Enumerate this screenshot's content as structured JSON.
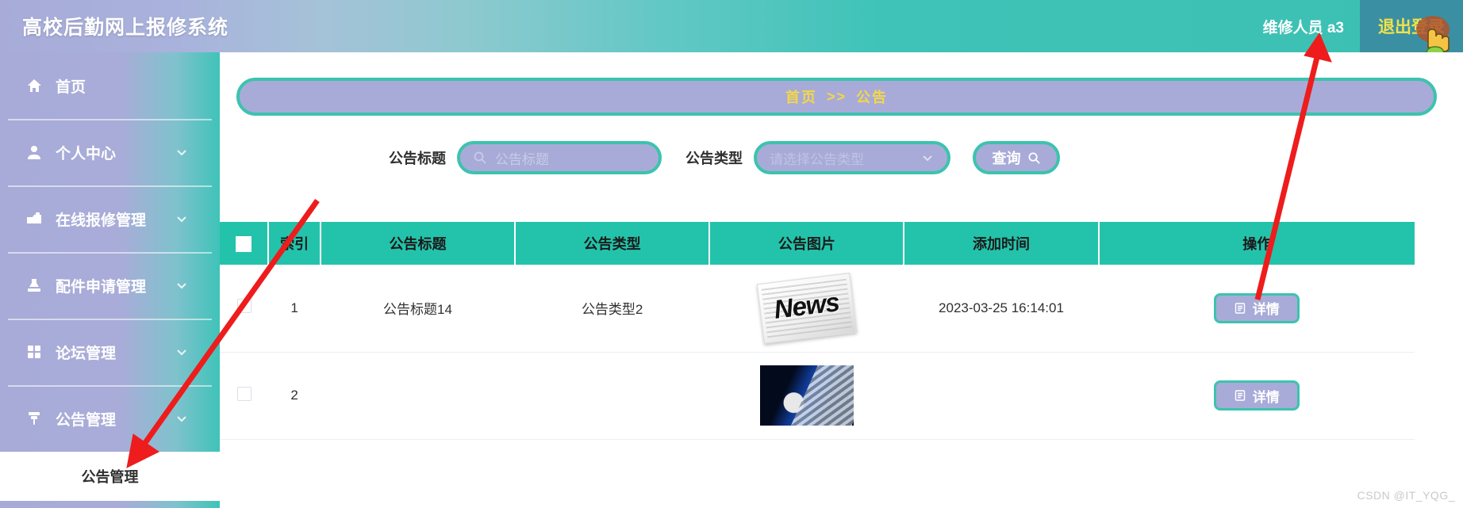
{
  "header": {
    "title": "高校后勤网上报修系统",
    "user_label": "维修人员 a3",
    "logout_label": "退出登录",
    "accent_teal": "#3cc3ae",
    "accent_purple": "#a8abd8",
    "logout_bg": "#3b8fa3",
    "logout_text_color": "#f0e24a"
  },
  "sidebar": {
    "items": [
      {
        "label": "首页",
        "icon": "home-icon",
        "has_chevron": false
      },
      {
        "label": "个人中心",
        "icon": "user-icon",
        "has_chevron": true
      },
      {
        "label": "在线报修管理",
        "icon": "tools-icon",
        "has_chevron": true
      },
      {
        "label": "配件申请管理",
        "icon": "stamp-icon",
        "has_chevron": true
      },
      {
        "label": "论坛管理",
        "icon": "grid-icon",
        "has_chevron": true
      },
      {
        "label": "公告管理",
        "icon": "pin-icon",
        "has_chevron": true
      }
    ],
    "submenu": {
      "label": "公告管理",
      "active": true
    }
  },
  "breadcrumb": {
    "root": "首页",
    "separator": ">>",
    "current": "公告"
  },
  "filters": {
    "title_label": "公告标题",
    "title_placeholder": "公告标题",
    "title_value": "",
    "type_label": "公告类型",
    "type_placeholder": "请选择公告类型",
    "type_value": "",
    "search_label": "查询",
    "search_icon": "magnifier-icon"
  },
  "table": {
    "headers": [
      "",
      "索引",
      "公告标题",
      "公告类型",
      "公告图片",
      "添加时间",
      "操作"
    ],
    "select_all_checked": true,
    "rows": [
      {
        "checked": false,
        "index": "1",
        "title": "公告标题14",
        "type": "公告类型2",
        "image": "news-paper-thumbnail",
        "time": "2023-03-25 16:14:01",
        "action_label": "详情",
        "action_icon": "document-icon"
      },
      {
        "checked": false,
        "index": "2",
        "title": "",
        "type": "",
        "image": "globe-keyboard-thumbnail",
        "time": "",
        "action_label": "详情",
        "action_icon": "document-icon"
      }
    ]
  },
  "annotations": {
    "arrow_to_logout": "red-arrow-pointing-to-logout-button",
    "arrow_to_submenu": "red-arrow-pointing-to-announcement-submenu",
    "cursor": "hand-pointer-cursor"
  },
  "watermark": "CSDN @IT_YQG_"
}
